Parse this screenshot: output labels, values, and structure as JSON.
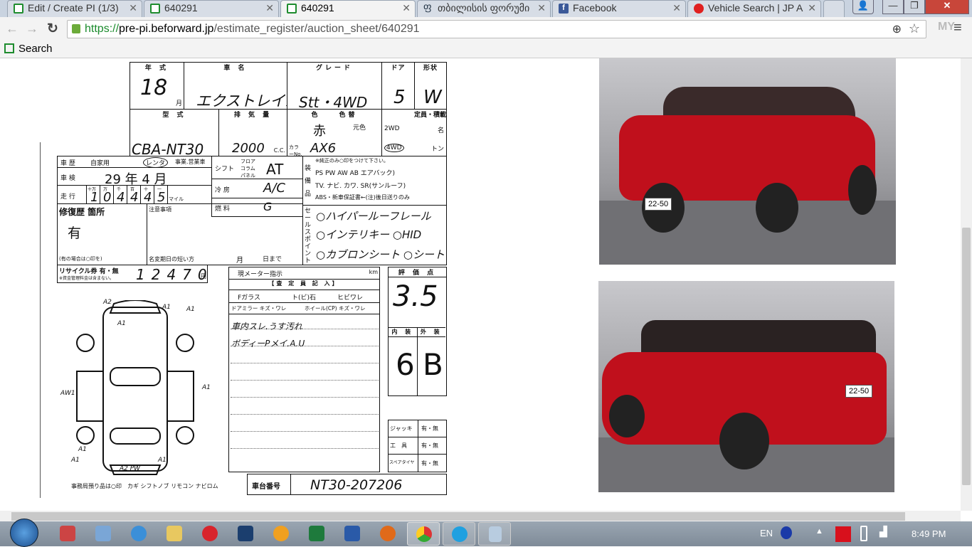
{
  "browser": {
    "tabs": [
      {
        "title": "Edit / Create PI (1/3)",
        "icon": "page-icon"
      },
      {
        "title": "640291",
        "icon": "page-icon"
      },
      {
        "title": "640291",
        "icon": "page-icon",
        "active": true
      },
      {
        "title": "თბილისის ფორუმი",
        "icon": "georgian-icon"
      },
      {
        "title": "Facebook",
        "icon": "facebook-icon"
      },
      {
        "title": "Vehicle Search | JP A",
        "icon": "vehicle-search-icon"
      }
    ],
    "url_scheme": "https://",
    "url_host": "pre-pi.beforward.jp",
    "url_path": "/estimate_register/auction_sheet/640291",
    "bookmark": "Search"
  },
  "sheet": {
    "h_year": "年 式",
    "h_name": "車 名",
    "h_grade": "グレード",
    "h_door": "ドア",
    "h_shape": "形状",
    "year": "18",
    "month_lbl": "月",
    "car_name": "エクストレイル",
    "grade": "Stt・4WD",
    "doors": "5",
    "shape": "W",
    "h_model": "型 式",
    "h_disp": "排 気 量",
    "h_color": "色",
    "h_colorchg": "色替",
    "h_cap": "定員・積載",
    "model": "CBA-NT30",
    "displacement": "2000",
    "cc": "C.C.",
    "color": "赤",
    "orig_color": "元色",
    "color_no_lbl": "カラーNo.",
    "color_no": "AX6",
    "wd2": "2WD",
    "wd4": "4WD",
    "cap_unit": "名",
    "ton": "トン",
    "hist_lbl": "車 歴",
    "hist_opts": [
      "自家用",
      "レンタ",
      "事業.営業車"
    ],
    "shaken_lbl": "車 検",
    "shaken": "29 年 4 月",
    "mileage_lbl": "走 行",
    "mileage_digits": [
      "1",
      "0",
      "4",
      "4",
      "4",
      "5"
    ],
    "mileage_units": [
      "十万",
      "万",
      "千",
      "百",
      "十",
      "一"
    ],
    "mile_lbl": "マイル",
    "shift_lbl": "シフト",
    "shift_opts": "フロア コラム パネル",
    "shift": "AT",
    "ac_lbl": "冷 房",
    "ac": "A/C",
    "fuel_lbl": "燃 料",
    "fuel": "G",
    "equip_lbl": "装備品",
    "equip_note": "※純正のみ○印をつけて下さい。",
    "equip_row1": "PS PW AW AB エアバック)",
    "equip_row2": "TV. ナビ. カワ. SR(サンルーフ)",
    "equip_row3": "ABS・新車保証書←(注)後日送りのみ",
    "repair_lbl": "修復歴 箇所",
    "repair": "有",
    "repair_note": "(有の場合は○印を)",
    "caution_lbl": "注意事項",
    "rename_lbl": "名変期日の短い方",
    "rename_m": "月",
    "rename_d": "日まで",
    "sales_lbl": "セールスポイント",
    "sales": [
      "○ハイパールーフレール",
      "○インテリキー ○HID",
      "○カブロンシート ○シートヒーター"
    ],
    "recycle_lbl": "リサイクル券 有・無",
    "recycle_note": "※資金管理料金は含まない。",
    "recycle": "12470",
    "yen": "円",
    "meter_lbl": "現メーター指示",
    "km": "km",
    "inspector_lbl": "【査 定 員 記 入】",
    "fglass": "Fガラス",
    "fglass_opts": "ト(ビ)石",
    "fglass_opts2": "ヒビワレ",
    "mirror": "ドアミラー キズ・ワレ",
    "wheel": "ホイール(CP) キズ・ワレ",
    "notes": [
      "車内スレ.うす汚れ",
      "ボディーPメイ.A.U"
    ],
    "score_lbl": "評 価 点",
    "score": "3.5",
    "int_lbl": "内 装",
    "ext_lbl": "外 装",
    "int": "6",
    "ext": "B",
    "jack": "ジャッキ",
    "tools": "工　具",
    "spare": "スペアタイヤ",
    "yesno": "有・無",
    "office_note": "事務局預り品は○印　カギ シフトノブ リモコン ナビロム",
    "chassis_lbl": "車台番号",
    "chassis": "NT30-207206",
    "diagram_marks": [
      "A2",
      "A1",
      "A1",
      "A1",
      "AW1",
      "A1",
      "A1",
      "A1",
      "A1",
      "A2 PW"
    ]
  },
  "photos": {
    "plate": "22-50"
  },
  "taskbar": {
    "lang": "EN",
    "time": "8:49 PM"
  }
}
